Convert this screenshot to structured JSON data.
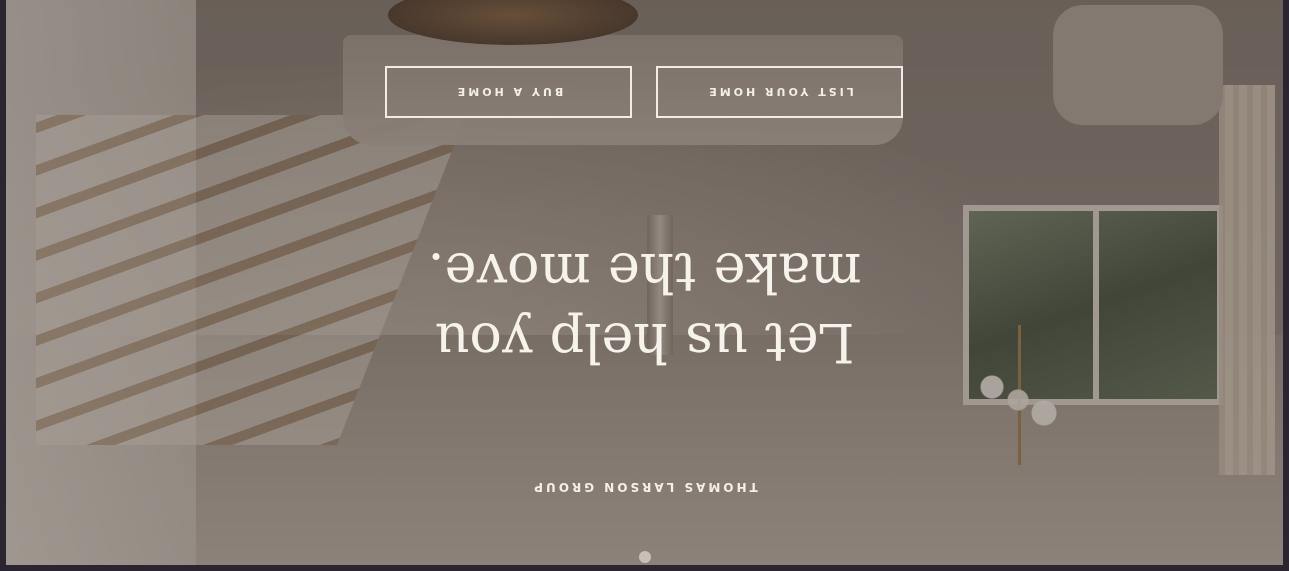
{
  "hero": {
    "brand": "THOMAS LARSON GROUP",
    "headline_line1": "Let us help you",
    "headline_line2": "make the move.",
    "buttons": {
      "list_your_home": "LIST YOUR HOME",
      "buy_a_home": "BUY A HOME"
    },
    "orientation": "rotated 180 degrees"
  }
}
